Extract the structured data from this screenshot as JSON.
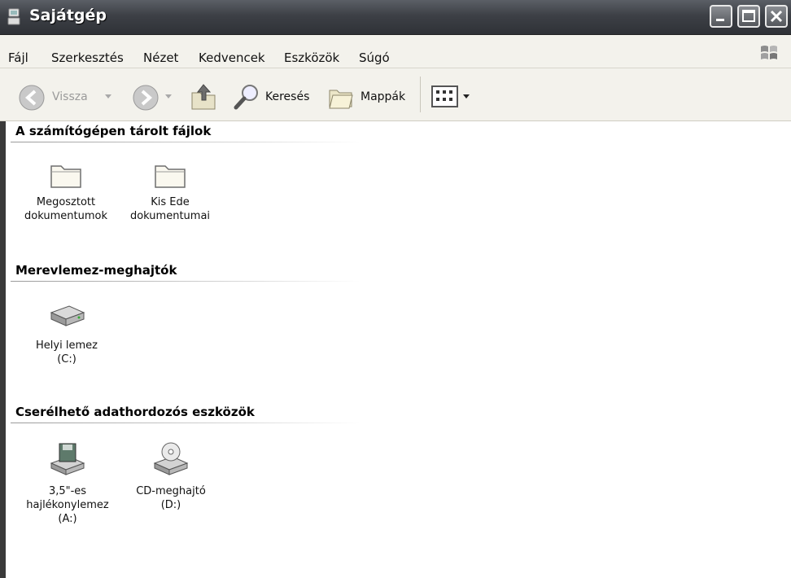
{
  "window": {
    "title": "Sajátgép"
  },
  "menu": {
    "items": [
      "Fájl",
      "Szerkesztés",
      "Nézet",
      "Kedvencek",
      "Eszközök",
      "Súgó"
    ]
  },
  "toolbar": {
    "back_label": "Vissza",
    "search_label": "Keresés",
    "folders_label": "Mappák"
  },
  "groups": [
    {
      "title": "A számítógépen tárolt fájlok",
      "items": [
        {
          "label": "Megosztott\ndokumentumok",
          "icon": "folder-icon"
        },
        {
          "label": "Kis Ede\ndokumentumai",
          "icon": "folder-icon"
        }
      ]
    },
    {
      "title": "Merevlemez-meghajtók",
      "items": [
        {
          "label": "Helyi lemez\n(C:)",
          "icon": "hard-drive-icon"
        }
      ]
    },
    {
      "title": "Cserélhető adathordozós eszközök",
      "items": [
        {
          "label": "3,5\"-es\nhajlékonylemez\n(A:)",
          "icon": "floppy-drive-icon"
        },
        {
          "label": "CD-meghajtó\n(D:)",
          "icon": "cd-drive-icon"
        }
      ]
    }
  ]
}
